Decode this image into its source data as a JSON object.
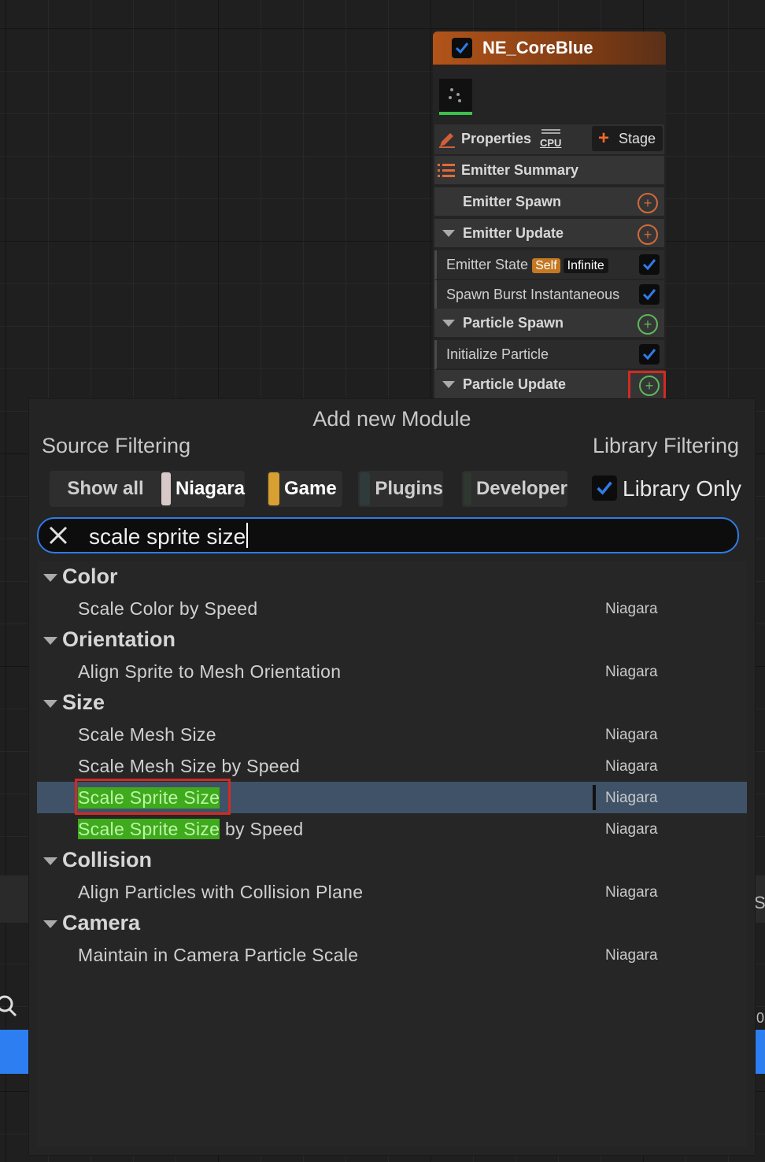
{
  "node": {
    "title": "NE_CoreBlue",
    "properties_label": "Properties",
    "cpu_label": "CPU",
    "stage_label": "Stage",
    "emitter_summary": "Emitter Summary",
    "emitter_spawn": "Emitter Spawn",
    "emitter_update": "Emitter Update",
    "emitter_state": "Emitter State",
    "self_tag": "Self",
    "infinite_tag": "Infinite",
    "spawn_burst": "Spawn Burst Instantaneous",
    "particle_spawn": "Particle Spawn",
    "initialize_particle": "Initialize Particle",
    "particle_update": "Particle Update"
  },
  "popup": {
    "title": "Add new Module",
    "source_filtering": "Source Filtering",
    "library_filtering": "Library Filtering",
    "chips": [
      {
        "label": "Show all",
        "color": ""
      },
      {
        "label": "Niagara",
        "color": "#d8c8c8"
      },
      {
        "label": "Game",
        "color": "#d8a030"
      },
      {
        "label": "Plugins",
        "color": "#2f3a3a"
      },
      {
        "label": "Developer",
        "color": "#2e3830"
      }
    ],
    "library_only": "Library Only",
    "search_value": "scale sprite size",
    "categories": [
      {
        "name": "Color",
        "items": [
          {
            "name": "Scale Color by Speed",
            "source": "Niagara"
          }
        ]
      },
      {
        "name": "Orientation",
        "items": [
          {
            "name": "Align Sprite to Mesh Orientation",
            "source": "Niagara"
          }
        ]
      },
      {
        "name": "Size",
        "items": [
          {
            "name": "Scale Mesh Size",
            "source": "Niagara"
          },
          {
            "name": "Scale Mesh Size by Speed",
            "source": "Niagara"
          },
          {
            "name": "Scale Sprite Size",
            "source": "Niagara"
          },
          {
            "name_highlight": "Scale Sprite Size",
            "name_rest": " by Speed",
            "source": "Niagara"
          }
        ]
      },
      {
        "name": "Collision",
        "items": [
          {
            "name": "Align Particles with Collision Plane",
            "source": "Niagara"
          }
        ]
      },
      {
        "name": "Camera",
        "items": [
          {
            "name": "Maintain in Camera Particle Scale",
            "source": "Niagara"
          }
        ]
      }
    ]
  },
  "background": {
    "right_glyph_s": "S",
    "right_glyph_0": "0"
  },
  "colors": {
    "accent_blue": "#2f7be8",
    "node_header": "#b2541a",
    "selection": "#3f5268",
    "match_highlight": "#3eaa1c",
    "callout_red": "#d32a22"
  }
}
